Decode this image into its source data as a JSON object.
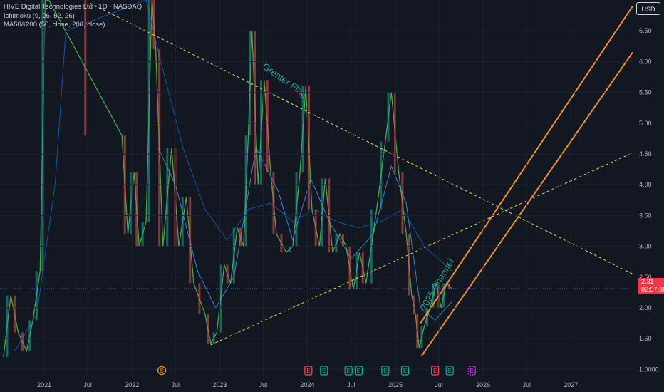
{
  "header": {
    "title": "HIVE Digital Technologies Ltd · 1D · NASDAQ",
    "indicator_1": "Ichimoku (9, 26, 52, 26)",
    "indicator_2": "MA50&200 (50, close, 200, close)"
  },
  "currency_button": "USD",
  "last_price": {
    "value": "2.31",
    "countdown": "02:57:36"
  },
  "colors": {
    "background": "#131722",
    "up": "#26a69a",
    "down": "#ef5350",
    "trendline_yellow": "#e6d84f",
    "channel_orange": "#f0922f",
    "drawing_text": "#26a69a",
    "price_tag": "#f23645"
  },
  "chart_data": {
    "type": "line",
    "title": "HIVE Digital Technologies Ltd · 1D · NASDAQ",
    "y_axis": {
      "ticks": [
        "6.50",
        "6.00",
        "5.50",
        "5.00",
        "4.50",
        "4.00",
        "3.50",
        "3.00",
        "2.50",
        "2.00",
        "1.50",
        "1.0000"
      ],
      "ylim": [
        0.9,
        7.0
      ]
    },
    "x_axis": {
      "ticks": [
        "2021",
        "Jul",
        "2022",
        "Jul",
        "2023",
        "Jul",
        "2024",
        "Jul",
        "2025",
        "Jul",
        "2026",
        "Jul",
        "2027"
      ],
      "xlim": [
        "2020-07-01",
        "2027-09-15"
      ]
    },
    "series": [
      {
        "name": "HIVE",
        "points": [
          [
            "2020-07-15",
            1.2
          ],
          [
            "2020-08-15",
            2.2
          ],
          [
            "2020-09-15",
            1.6
          ],
          [
            "2020-10-20",
            1.3
          ],
          [
            "2020-11-15",
            1.8
          ],
          [
            "2020-12-15",
            2.6
          ],
          [
            "2021-01-05",
            7.0
          ],
          [
            "2021-01-20",
            7.0
          ],
          [
            "2021-11-20",
            4.8
          ],
          [
            "2021-12-15",
            3.2
          ],
          [
            "2022-01-10",
            4.2
          ],
          [
            "2022-01-31",
            3.0
          ],
          [
            "2022-03-01",
            3.4
          ],
          [
            "2022-03-25",
            7.0
          ],
          [
            "2022-04-10",
            6.2
          ],
          [
            "2022-05-10",
            3.0
          ],
          [
            "2022-06-15",
            4.6
          ],
          [
            "2022-07-15",
            3.0
          ],
          [
            "2022-08-15",
            3.8
          ],
          [
            "2022-09-15",
            2.4
          ],
          [
            "2022-11-01",
            1.9
          ],
          [
            "2022-11-25",
            1.42
          ],
          [
            "2022-12-20",
            1.6
          ],
          [
            "2023-01-20",
            2.7
          ],
          [
            "2023-02-15",
            2.4
          ],
          [
            "2023-03-15",
            3.3
          ],
          [
            "2023-04-10",
            3.0
          ],
          [
            "2023-04-30",
            4.8
          ],
          [
            "2023-05-15",
            6.5
          ],
          [
            "2023-06-10",
            4.0
          ],
          [
            "2023-07-05",
            5.7
          ],
          [
            "2023-08-01",
            4.2
          ],
          [
            "2023-08-25",
            3.2
          ],
          [
            "2023-10-05",
            2.9
          ],
          [
            "2023-11-01",
            3.0
          ],
          [
            "2023-12-01",
            4.2
          ],
          [
            "2023-12-25",
            5.6
          ],
          [
            "2024-01-20",
            3.6
          ],
          [
            "2024-02-20",
            3.0
          ],
          [
            "2024-03-15",
            4.1
          ],
          [
            "2024-04-15",
            2.9
          ],
          [
            "2024-05-15",
            3.2
          ],
          [
            "2024-06-10",
            3.0
          ],
          [
            "2024-07-10",
            2.3
          ],
          [
            "2024-08-05",
            2.9
          ],
          [
            "2024-09-01",
            2.4
          ],
          [
            "2024-10-15",
            3.6
          ],
          [
            "2024-11-20",
            4.7
          ],
          [
            "2024-12-15",
            5.5
          ],
          [
            "2025-01-15",
            4.2
          ],
          [
            "2025-02-15",
            3.2
          ],
          [
            "2025-03-10",
            2.2
          ],
          [
            "2025-03-25",
            1.9
          ],
          [
            "2025-04-10",
            1.35
          ],
          [
            "2025-05-01",
            1.7
          ],
          [
            "2025-05-25",
            2.0
          ],
          [
            "2025-06-20",
            2.4
          ],
          [
            "2025-07-10",
            2.0
          ],
          [
            "2025-08-01",
            2.4
          ],
          [
            "2025-08-25",
            2.31
          ]
        ]
      },
      {
        "name": "MA50",
        "points": [
          [
            "2022-04-20",
            4.6
          ],
          [
            "2022-07-01",
            4.0
          ],
          [
            "2022-10-01",
            2.6
          ],
          [
            "2022-12-15",
            2.0
          ],
          [
            "2023-03-01",
            2.5
          ],
          [
            "2023-06-01",
            4.6
          ],
          [
            "2023-09-01",
            3.9
          ],
          [
            "2023-11-01",
            3.1
          ],
          [
            "2024-01-15",
            4.1
          ],
          [
            "2024-04-01",
            3.4
          ],
          [
            "2024-07-01",
            2.8
          ],
          [
            "2024-10-01",
            3.2
          ],
          [
            "2024-12-15",
            4.3
          ],
          [
            "2025-02-15",
            3.7
          ],
          [
            "2025-04-15",
            2.0
          ],
          [
            "2025-06-15",
            1.8
          ],
          [
            "2025-08-25",
            2.1
          ]
        ]
      },
      {
        "name": "MA200",
        "points": [
          [
            "2020-09-01",
            1.3
          ],
          [
            "2020-12-01",
            1.9
          ],
          [
            "2021-02-15",
            4.0
          ],
          [
            "2021-04-01",
            6.5
          ],
          [
            "2022-03-01",
            7.0
          ],
          [
            "2022-05-01",
            6.0
          ],
          [
            "2022-08-01",
            4.6
          ],
          [
            "2022-11-01",
            3.6
          ],
          [
            "2023-02-01",
            3.1
          ],
          [
            "2023-05-01",
            3.6
          ],
          [
            "2023-08-01",
            3.7
          ],
          [
            "2023-11-01",
            3.4
          ],
          [
            "2024-02-01",
            3.6
          ],
          [
            "2024-05-01",
            3.4
          ],
          [
            "2024-08-01",
            3.3
          ],
          [
            "2024-11-01",
            3.4
          ],
          [
            "2025-02-01",
            3.6
          ],
          [
            "2025-05-01",
            3.0
          ],
          [
            "2025-08-25",
            2.6
          ]
        ]
      }
    ],
    "drawings": [
      {
        "kind": "trendline",
        "name": "Greater Flag upper",
        "from": [
          "2021-07-10",
          6.95
        ],
        "to": [
          "2027-09-15",
          2.55
        ]
      },
      {
        "kind": "trendline",
        "name": "Greater Flag lower",
        "from": [
          "2022-11-25",
          1.4
        ],
        "to": [
          "2027-09-15",
          4.52
        ]
      },
      {
        "kind": "channel",
        "name": "2025 Channel upper",
        "from": [
          "2025-04-15",
          1.75
        ],
        "to": [
          "2027-09-15",
          6.9
        ]
      },
      {
        "kind": "channel",
        "name": "2025 Channel lower",
        "from": [
          "2025-04-20",
          1.22
        ],
        "to": [
          "2027-09-15",
          6.15
        ]
      }
    ],
    "annotations": [
      {
        "text": "Greater Flag",
        "at": [
          "2023-06-25",
          5.9
        ]
      },
      {
        "text": "2025 Channel",
        "at": [
          "2025-05-05",
          1.95
        ]
      }
    ],
    "event_markers": [
      {
        "letter": "S",
        "date": "2022-05-05",
        "color": "#f0922f"
      },
      {
        "letter": "E",
        "date": "2024-01-05",
        "color": "#ef5350"
      },
      {
        "letter": "E",
        "date": "2024-03-10",
        "color": "#26a69a"
      },
      {
        "letter": "E",
        "date": "2024-06-20",
        "color": "#26a69a"
      },
      {
        "letter": "E",
        "date": "2024-08-01",
        "color": "#26a69a"
      },
      {
        "letter": "E",
        "date": "2024-11-20",
        "color": "#26a69a"
      },
      {
        "letter": "E",
        "date": "2025-02-10",
        "color": "#26a69a"
      },
      {
        "letter": "E",
        "date": "2025-06-15",
        "color": "#ef5350"
      },
      {
        "letter": "E",
        "date": "2025-08-15",
        "color": "#26a69a"
      },
      {
        "letter": "E",
        "date": "2025-11-15",
        "color": "#e040fb"
      }
    ],
    "grid": true,
    "legend": "top-left"
  }
}
